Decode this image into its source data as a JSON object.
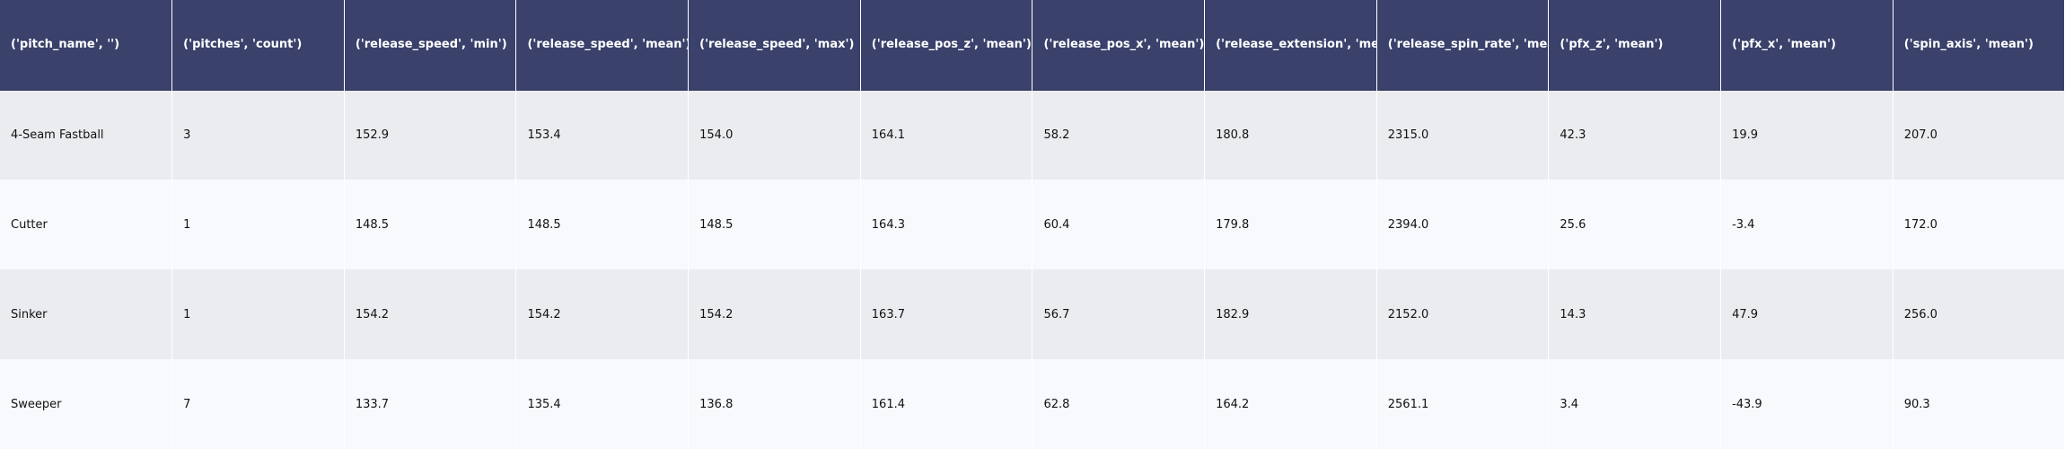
{
  "table": {
    "columns": [
      "('pitch_name', '')",
      "('pitches', 'count')",
      "('release_speed', 'min')",
      "('release_speed', 'mean')",
      "('release_speed', 'max')",
      "('release_pos_z', 'mean')",
      "('release_pos_x', 'mean')",
      "('release_extension', 'mean')",
      "('release_spin_rate', 'mean')",
      "('pfx_z', 'mean')",
      "('pfx_x', 'mean')",
      "('spin_axis', 'mean')"
    ],
    "rows": [
      [
        "4-Seam Fastball",
        "3",
        "152.9",
        "153.4",
        "154.0",
        "164.1",
        "58.2",
        "180.8",
        "2315.0",
        "42.3",
        "19.9",
        "207.0"
      ],
      [
        "Cutter",
        "1",
        "148.5",
        "148.5",
        "148.5",
        "164.3",
        "60.4",
        "179.8",
        "2394.0",
        "25.6",
        "-3.4",
        "172.0"
      ],
      [
        "Sinker",
        "1",
        "154.2",
        "154.2",
        "154.2",
        "163.7",
        "56.7",
        "182.9",
        "2152.0",
        "14.3",
        "47.9",
        "256.0"
      ],
      [
        "Sweeper",
        "7",
        "133.7",
        "135.4",
        "136.8",
        "161.4",
        "62.8",
        "164.2",
        "2561.1",
        "3.4",
        "-43.9",
        "90.3"
      ]
    ]
  },
  "colors": {
    "header_bg": "#3a416b",
    "row_odd_bg": "#ebecf0",
    "row_even_bg": "#f7f9fd"
  }
}
